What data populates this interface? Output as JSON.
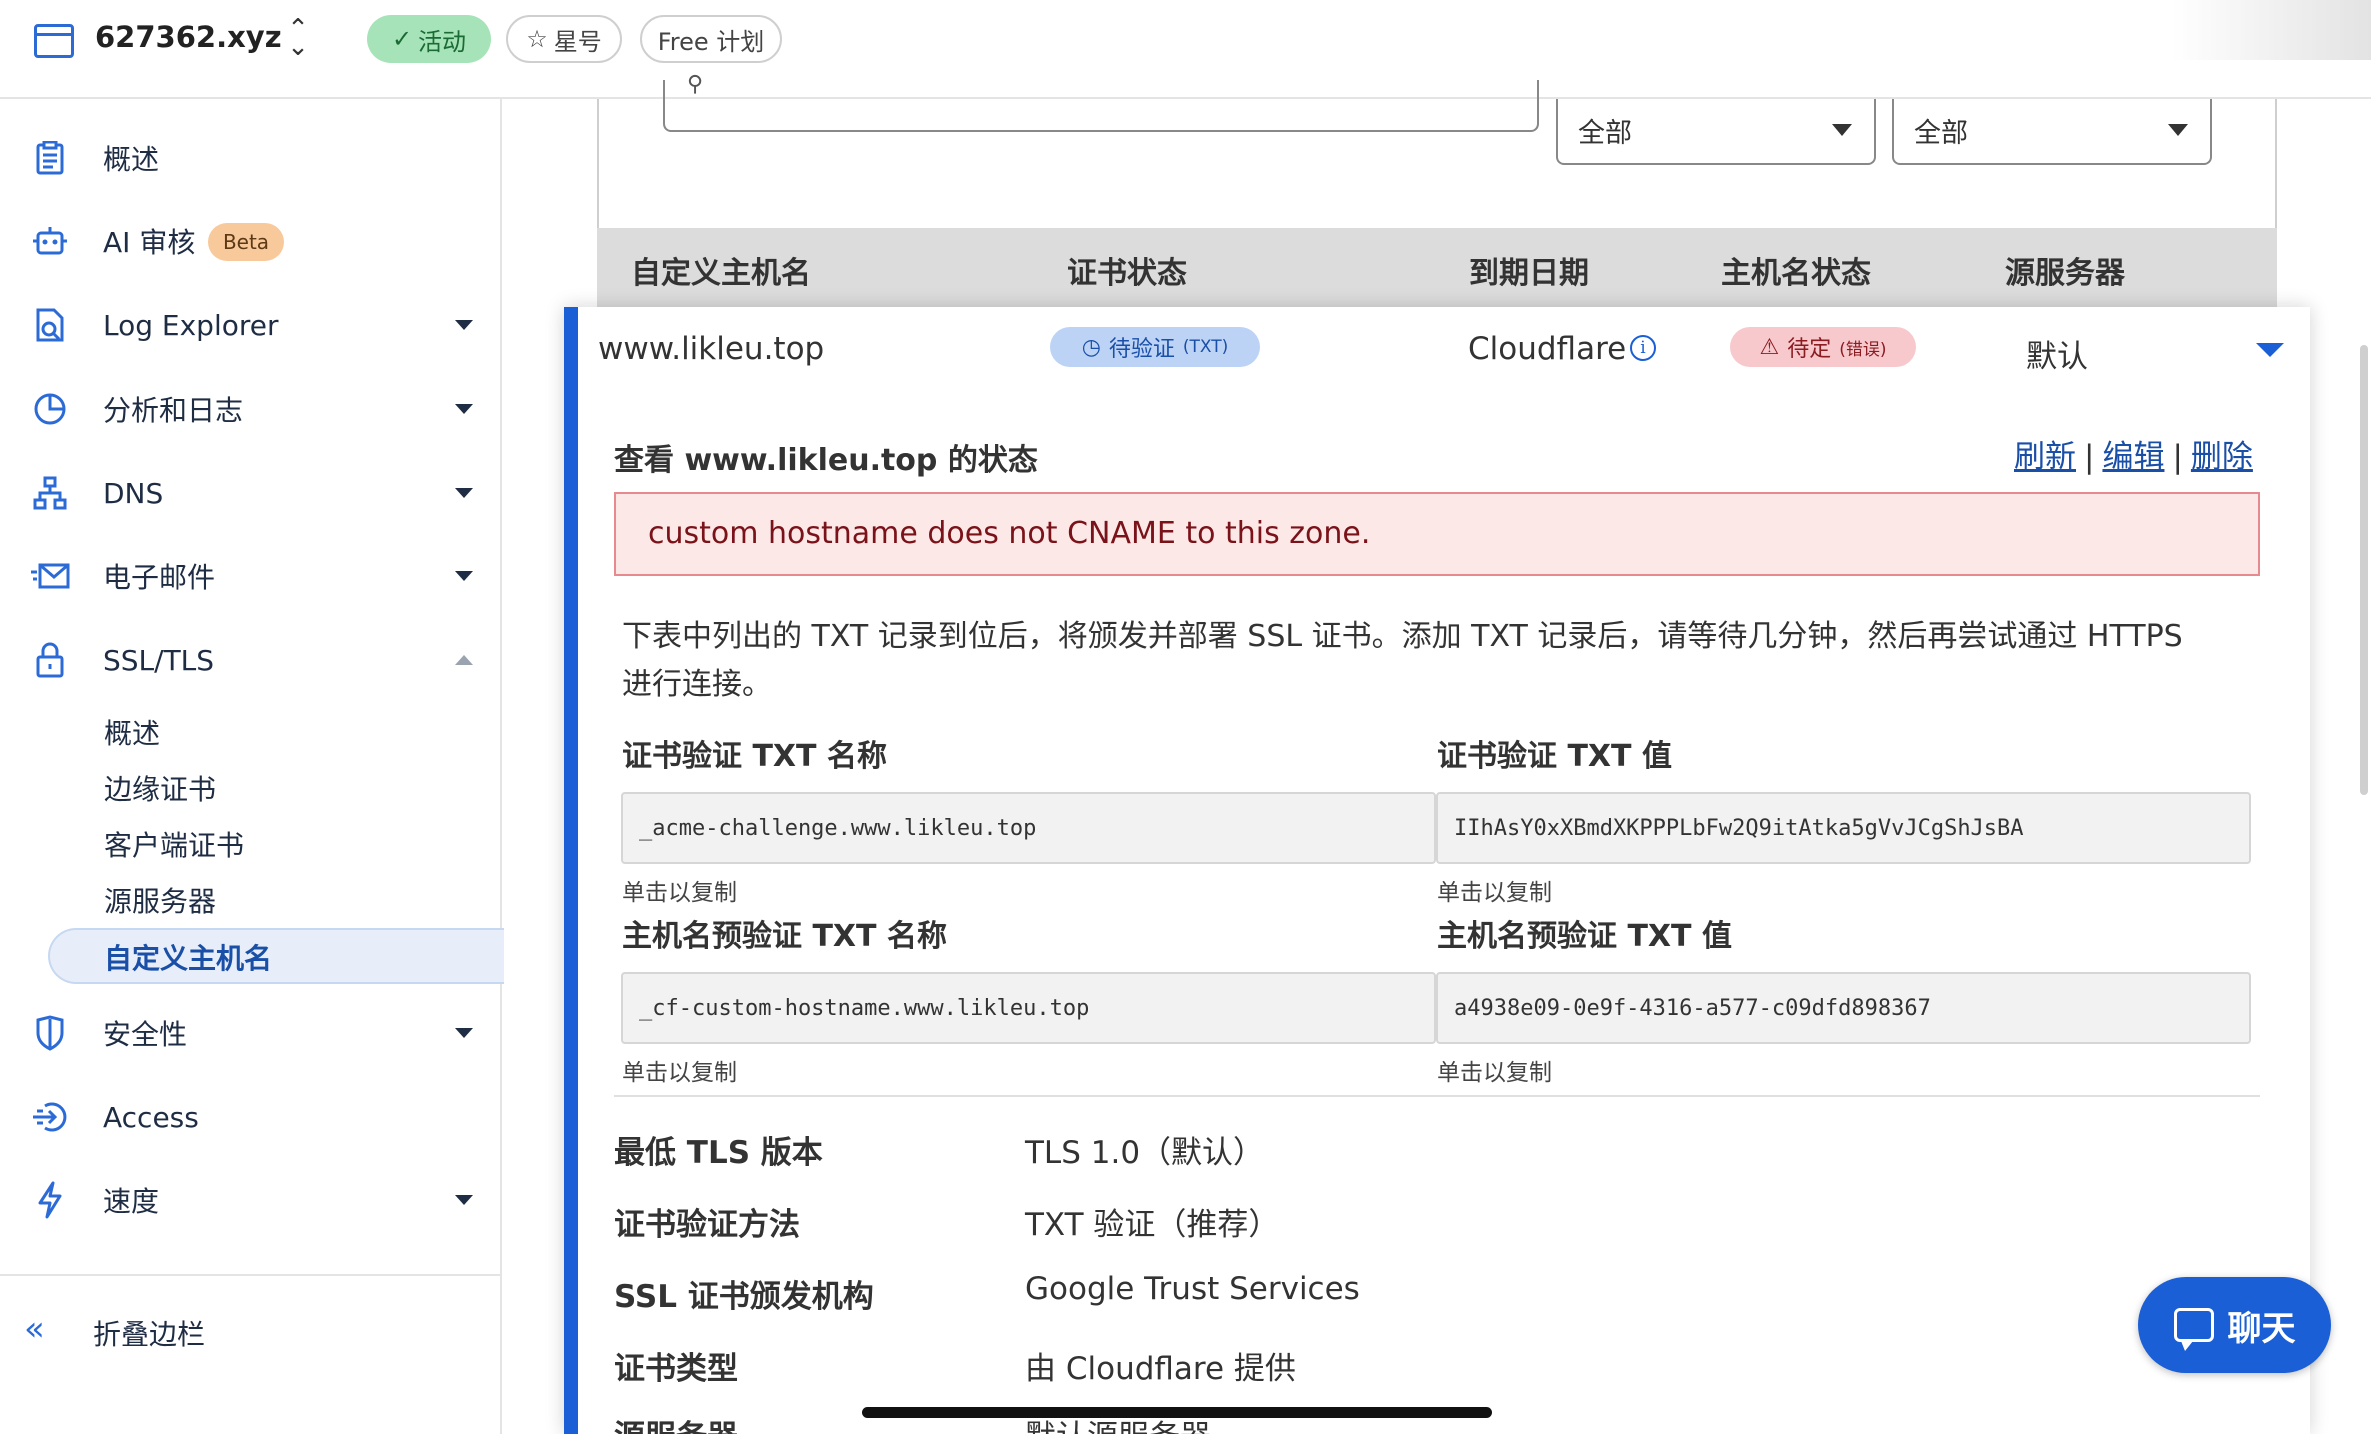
{
  "header": {
    "site_name": "627362.xyz",
    "status_label": "活动",
    "star_label": "星号",
    "plan_label": "Free 计划"
  },
  "sidebar": {
    "items": [
      {
        "label": "概述",
        "icon": "clipboard-icon"
      },
      {
        "label": "AI 审核",
        "icon": "robot-icon",
        "badge": "Beta"
      },
      {
        "label": "Log Explorer",
        "icon": "log-icon"
      },
      {
        "label": "分析和日志",
        "icon": "pie-chart-icon"
      },
      {
        "label": "DNS",
        "icon": "network-icon"
      },
      {
        "label": "电子邮件",
        "icon": "mail-icon"
      },
      {
        "label": "SSL/TLS",
        "icon": "lock-icon"
      },
      {
        "label": "安全性",
        "icon": "shield-icon"
      },
      {
        "label": "Access",
        "icon": "access-icon"
      },
      {
        "label": "速度",
        "icon": "lightning-icon"
      }
    ],
    "ssl_sub_items": [
      "概述",
      "边缘证书",
      "客户端证书",
      "源服务器"
    ],
    "ssl_active_sub_item": "自定义主机名",
    "collapse_label": "折叠边栏"
  },
  "filters": {
    "select_1": "全部",
    "select_2": "全部"
  },
  "table": {
    "headers": [
      "自定义主机名",
      "证书状态",
      "到期日期",
      "主机名状态",
      "源服务器"
    ],
    "row": {
      "hostname": "www.likleu.top",
      "cert_status": "待验证",
      "cert_status_detail": "(TXT)",
      "expiry": "Cloudflare",
      "hostname_status": "待定",
      "hostname_status_detail": "(错误)",
      "origin": "默认"
    }
  },
  "detail": {
    "title": "查看 www.likleu.top 的状态",
    "actions": {
      "refresh": "刷新",
      "edit": "编辑",
      "delete": "删除"
    },
    "error_message": "custom hostname does not CNAME to this zone.",
    "description": "下表中列出的 TXT 记录到位后，将颁发并部署 SSL 证书。添加 TXT 记录后，请等待几分钟，然后再尝试通过 HTTPS 进行连接。",
    "copy_hint": "单击以复制",
    "cert_txt_name_label": "证书验证 TXT 名称",
    "cert_txt_name_value": "_acme-challenge.www.likleu.top",
    "cert_txt_value_label": "证书验证 TXT 值",
    "cert_txt_value_value": "IIhAsY0xXBmdXKPPPLbFw2Q9itAtka5gVvJCgShJsBA",
    "host_txt_name_label": "主机名预验证 TXT 名称",
    "host_txt_name_value": "_cf-custom-hostname.www.likleu.top",
    "host_txt_value_label": "主机名预验证 TXT 值",
    "host_txt_value_value": "a4938e09-0e9f-4316-a577-c09dfd898367",
    "properties": [
      {
        "key": "最低 TLS 版本",
        "value": "TLS 1.0（默认）"
      },
      {
        "key": "证书验证方法",
        "value": "TXT 验证（推荐）"
      },
      {
        "key": "SSL 证书颁发机构",
        "value": "Google Trust Services"
      },
      {
        "key": "证书类型",
        "value": "由 Cloudflare 提供"
      },
      {
        "key": "源服务器",
        "value": "默认源服务器"
      }
    ]
  },
  "chat": {
    "label": "聊天"
  },
  "colors": {
    "accent": "#1a5fd6",
    "active_pill": "#a6e3b8",
    "error_bg": "#fde8e8",
    "pending_badge": "#bcd3f5",
    "error_badge": "#f7c9cc",
    "beta_badge": "#f8c99b"
  }
}
